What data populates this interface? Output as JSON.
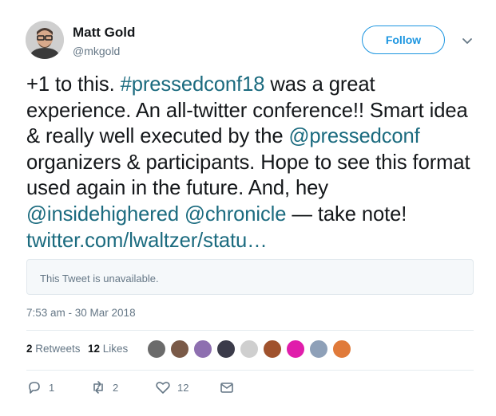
{
  "author": {
    "name": "Matt Gold",
    "handle": "@mkgold"
  },
  "follow_label": "Follow",
  "tweet_segments": [
    {
      "text": "+1 to this. ",
      "link": false
    },
    {
      "text": "#pressedconf18",
      "link": true
    },
    {
      "text": " was a great experience. An all-twitter conference!! Smart idea & really well executed by the ",
      "link": false
    },
    {
      "text": "@pressedconf",
      "link": true
    },
    {
      "text": " organizers & participants. Hope to see this format used again in the future. And, hey ",
      "link": false
    },
    {
      "text": "@insidehighered",
      "link": true
    },
    {
      "text": " ",
      "link": false
    },
    {
      "text": "@chronicle",
      "link": true
    },
    {
      "text": " — take note! ",
      "link": false
    },
    {
      "text": "twitter.com/lwaltzer/statu…",
      "link": true
    }
  ],
  "quote": {
    "text": "This Tweet is unavailable."
  },
  "timestamp": "7:53 am - 30 Mar 2018",
  "stats": {
    "retweets_count": "2",
    "retweets_label": "Retweets",
    "likes_count": "12",
    "likes_label": "Likes"
  },
  "liker_avatars": [
    {
      "color": "#6b6b6b"
    },
    {
      "color": "#7a5a48"
    },
    {
      "color": "#8e6fb0"
    },
    {
      "color": "#3b3b4a"
    },
    {
      "color": "#cfcfcf"
    },
    {
      "color": "#a0522d"
    },
    {
      "color": "#e01dab"
    },
    {
      "color": "#8ea0b8"
    },
    {
      "color": "#e07a3a"
    }
  ],
  "actions": {
    "reply_count": "1",
    "retweet_count": "2",
    "like_count": "12"
  },
  "colors": {
    "link": "#1b6b7f",
    "follow": "#1b95e0",
    "meta": "#657786"
  }
}
